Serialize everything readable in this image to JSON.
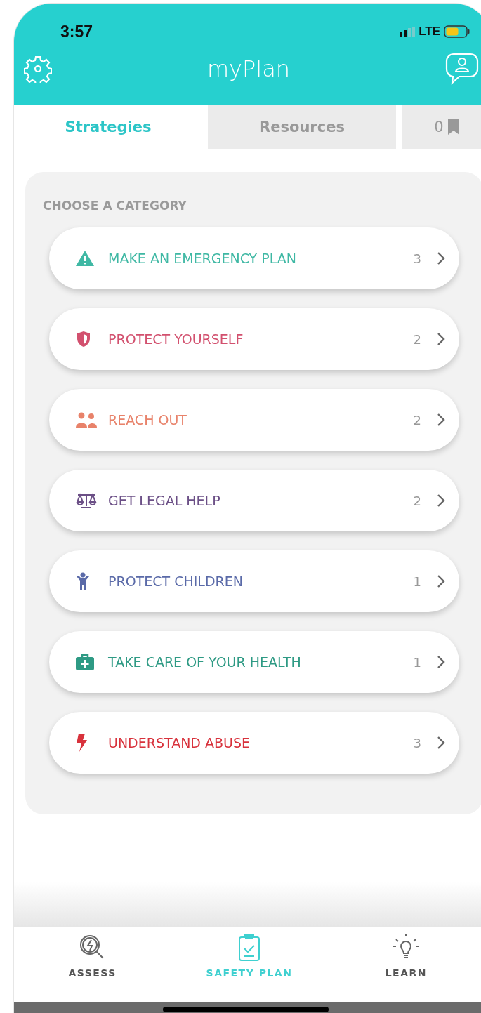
{
  "status_bar": {
    "time": "3:57",
    "network": "LTE"
  },
  "header": {
    "title": "myPlan"
  },
  "tabs": [
    {
      "label": "Strategies",
      "selected": true
    },
    {
      "label": "Resources",
      "selected": false
    },
    {
      "label": "0",
      "kind": "bookmarks",
      "selected": false
    }
  ],
  "section_title": "CHOOSE A CATEGORY",
  "categories": [
    {
      "label": "MAKE AN EMERGENCY PLAN",
      "count": "3",
      "kind": "warning",
      "color": "#3fb8a4"
    },
    {
      "label": "PROTECT YOURSELF",
      "count": "2",
      "kind": "shield",
      "color": "#d2506e"
    },
    {
      "label": "REACH OUT",
      "count": "2",
      "kind": "people",
      "color": "#e8826a"
    },
    {
      "label": "GET LEGAL HELP",
      "count": "2",
      "kind": "scales",
      "color": "#6b4f86"
    },
    {
      "label": "PROTECT CHILDREN",
      "count": "1",
      "kind": "child",
      "color": "#5a6aa8"
    },
    {
      "label": "TAKE CARE OF YOUR HEALTH",
      "count": "1",
      "kind": "medkit",
      "color": "#2e9a84"
    },
    {
      "label": "UNDERSTAND ABUSE",
      "count": "3",
      "kind": "bolt",
      "color": "#d8323c"
    }
  ],
  "bottom_nav": [
    {
      "label": "ASSESS",
      "kind": "assess",
      "selected": false
    },
    {
      "label": "SAFETY PLAN",
      "kind": "plan",
      "selected": true
    },
    {
      "label": "LEARN",
      "kind": "learn",
      "selected": false
    }
  ]
}
